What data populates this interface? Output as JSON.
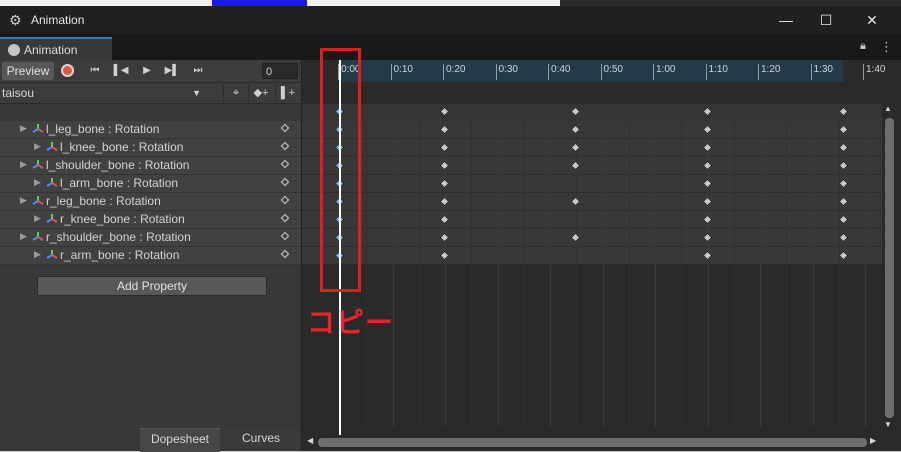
{
  "window": {
    "title": "Animation",
    "minimize": "—",
    "maximize": "☐",
    "close": "✕"
  },
  "tab": {
    "label": "Animation"
  },
  "toolbar": {
    "preview_label": "Preview",
    "first_key": "⏮",
    "prev_key": "▌◀",
    "play": "▶",
    "next_key": "▶▌",
    "last_key": "⏭",
    "frame_value": "0",
    "clip_name": "taisou",
    "clip_arrow": "▼",
    "add_keyframe": "◆+",
    "add_event": "▌+",
    "key_icon": "⌖"
  },
  "properties": [
    {
      "label": "l_leg_bone : Rotation",
      "indent": 0
    },
    {
      "label": "l_knee_bone : Rotation",
      "indent": 1
    },
    {
      "label": "l_shoulder_bone : Rotation",
      "indent": 0
    },
    {
      "label": "l_arm_bone : Rotation",
      "indent": 1
    },
    {
      "label": "r_leg_bone : Rotation",
      "indent": 0
    },
    {
      "label": "r_knee_bone : Rotation",
      "indent": 1
    },
    {
      "label": "r_shoulder_bone : Rotation",
      "indent": 0
    },
    {
      "label": "r_arm_bone : Rotation",
      "indent": 1
    }
  ],
  "add_property_label": "Add Property",
  "bottom_tabs": {
    "dopesheet": "Dopesheet",
    "curves": "Curves"
  },
  "ruler": {
    "ticks": [
      "0:00",
      "0:10",
      "0:20",
      "0:30",
      "0:40",
      "0:50",
      "1:00",
      "1:10",
      "1:20",
      "1:30",
      "1:40"
    ]
  },
  "keyframes": {
    "summary": [
      "0:00",
      "0:20",
      "0:45",
      "1:10",
      "1:36"
    ],
    "rows": [
      [
        "0:00",
        "0:20",
        "0:45",
        "1:10",
        "1:36"
      ],
      [
        "0:00",
        "0:20",
        "0:45",
        "1:10",
        "1:36"
      ],
      [
        "0:00",
        "0:20",
        "0:45",
        "1:10",
        "1:36"
      ],
      [
        "0:00",
        "0:20",
        "1:10",
        "1:36"
      ],
      [
        "0:00",
        "0:20",
        "0:45",
        "1:10",
        "1:36"
      ],
      [
        "0:00",
        "0:20",
        "1:10",
        "1:36"
      ],
      [
        "0:00",
        "0:20",
        "0:45",
        "1:10",
        "1:36"
      ],
      [
        "0:00",
        "0:20",
        "1:10",
        "1:36"
      ]
    ],
    "selected_column": "0:00"
  },
  "annotation_text": "コピー",
  "colors": {
    "annotation": "#e8232b",
    "playhead": "#ffffff",
    "tab_accent": "#3a79bb",
    "selected_key": "#7fb0ff"
  }
}
